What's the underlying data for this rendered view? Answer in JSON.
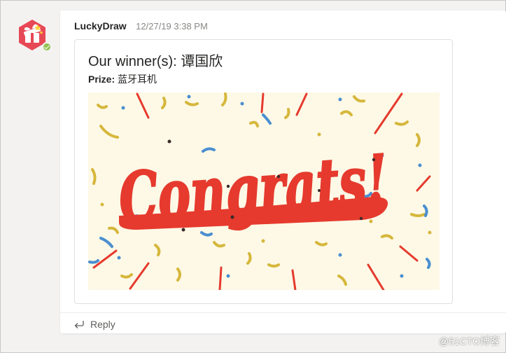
{
  "message": {
    "sender": "LuckyDraw",
    "timestamp": "12/27/19 3:38 PM",
    "avatar_icon": "gift-box-icon",
    "presence_status": "available",
    "card": {
      "title": "Our winner(s): 谭国欣",
      "prize_label": "Prize:",
      "prize_value": "蓝牙耳机",
      "image_text": "Congrats!"
    },
    "reply_label": "Reply",
    "reply_icon": "reply-arrow-icon"
  },
  "watermark": "@51CTO博客",
  "colors": {
    "avatar_red": "#e74856",
    "presence_green": "#92c353",
    "congrats_red": "#e63a2e",
    "confetti_yellow": "#d6b73c",
    "confetti_blue": "#4a8ed0",
    "image_background": "#fdf9e6"
  }
}
